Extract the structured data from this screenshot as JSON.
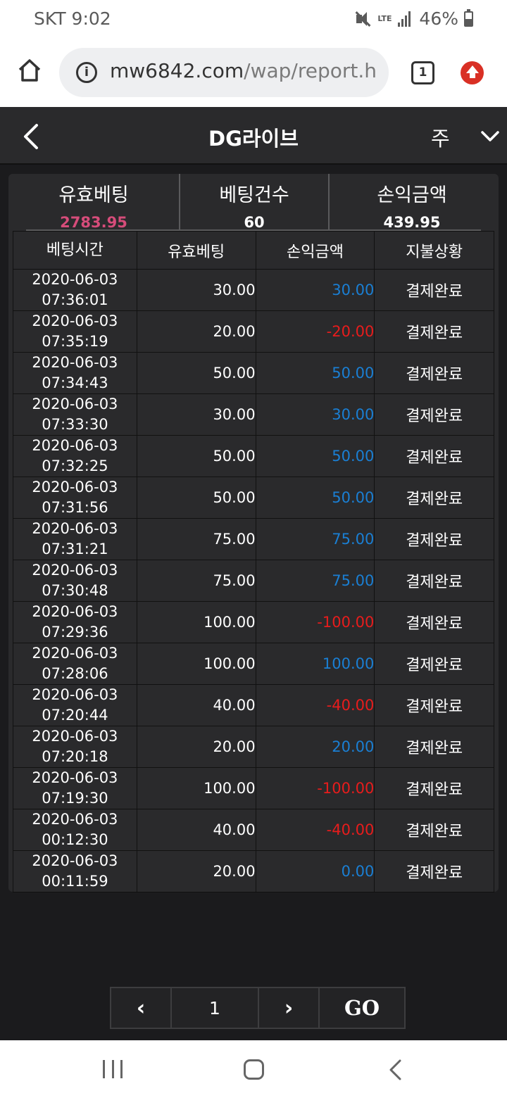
{
  "status_bar": {
    "carrier_time": "SKT 9:02",
    "network": "LTE",
    "battery": "46%",
    "battery_level": 0.46
  },
  "browser": {
    "url_host": "mw6842.com",
    "url_rest": "/wap/report.h",
    "tab_count": "1"
  },
  "header": {
    "title": "DG라이브",
    "period": "주"
  },
  "summary": [
    {
      "label": "유효베팅",
      "value": "2783.95",
      "accent": "#d64c7a"
    },
    {
      "label": "베팅건수",
      "value": "60"
    },
    {
      "label": "손익금액",
      "value": "439.95"
    }
  ],
  "table": {
    "columns": [
      "베팅시간",
      "유효베팅",
      "손익금액",
      "지불상황"
    ],
    "rows": [
      {
        "date": "2020-06-03",
        "time": "07:36:01",
        "bet": "30.00",
        "pl": "30.00",
        "status": "결제완료"
      },
      {
        "date": "2020-06-03",
        "time": "07:35:19",
        "bet": "20.00",
        "pl": "-20.00",
        "status": "결제완료"
      },
      {
        "date": "2020-06-03",
        "time": "07:34:43",
        "bet": "50.00",
        "pl": "50.00",
        "status": "결제완료"
      },
      {
        "date": "2020-06-03",
        "time": "07:33:30",
        "bet": "30.00",
        "pl": "30.00",
        "status": "결제완료"
      },
      {
        "date": "2020-06-03",
        "time": "07:32:25",
        "bet": "50.00",
        "pl": "50.00",
        "status": "결제완료"
      },
      {
        "date": "2020-06-03",
        "time": "07:31:56",
        "bet": "50.00",
        "pl": "50.00",
        "status": "결제완료"
      },
      {
        "date": "2020-06-03",
        "time": "07:31:21",
        "bet": "75.00",
        "pl": "75.00",
        "status": "결제완료"
      },
      {
        "date": "2020-06-03",
        "time": "07:30:48",
        "bet": "75.00",
        "pl": "75.00",
        "status": "결제완료"
      },
      {
        "date": "2020-06-03",
        "time": "07:29:36",
        "bet": "100.00",
        "pl": "-100.00",
        "status": "결제완료"
      },
      {
        "date": "2020-06-03",
        "time": "07:28:06",
        "bet": "100.00",
        "pl": "100.00",
        "status": "결제완료"
      },
      {
        "date": "2020-06-03",
        "time": "07:20:44",
        "bet": "40.00",
        "pl": "-40.00",
        "status": "결제완료"
      },
      {
        "date": "2020-06-03",
        "time": "07:20:18",
        "bet": "20.00",
        "pl": "20.00",
        "status": "결제완료"
      },
      {
        "date": "2020-06-03",
        "time": "07:19:30",
        "bet": "100.00",
        "pl": "-100.00",
        "status": "결제완료"
      },
      {
        "date": "2020-06-03",
        "time": "00:12:30",
        "bet": "40.00",
        "pl": "-40.00",
        "status": "결제완료"
      },
      {
        "date": "2020-06-03",
        "time": "00:11:59",
        "bet": "20.00",
        "pl": "0.00",
        "status": "결제완료"
      }
    ]
  },
  "pager": {
    "prev": "‹",
    "page": "1",
    "next": "›",
    "go": "GO"
  },
  "colors": {
    "positive": "#1a7fd4",
    "negative": "#e81c1c"
  }
}
